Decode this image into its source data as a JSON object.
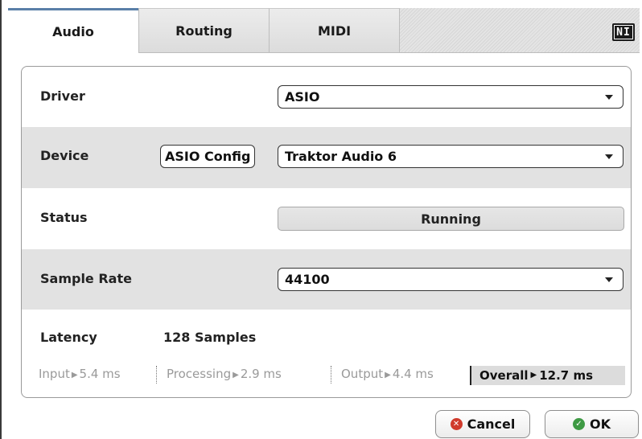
{
  "tabs": [
    {
      "label": "Audio",
      "active": true
    },
    {
      "label": "Routing",
      "active": false
    },
    {
      "label": "MIDI",
      "active": false
    }
  ],
  "logo_text": "NI",
  "settings": {
    "driver": {
      "label": "Driver",
      "value": "ASIO"
    },
    "device": {
      "label": "Device",
      "config_button": "ASIO Config",
      "value": "Traktor Audio 6"
    },
    "status": {
      "label": "Status",
      "value": "Running"
    },
    "sample_rate": {
      "label": "Sample Rate",
      "value": "44100"
    }
  },
  "latency": {
    "label": "Latency",
    "value": "128 Samples",
    "input": {
      "label": "Input",
      "value": "5.4 ms"
    },
    "processing": {
      "label": "Processing",
      "value": "2.9 ms"
    },
    "output": {
      "label": "Output",
      "value": "4.4 ms"
    },
    "overall": {
      "label": "Overall",
      "value": "12.7 ms"
    },
    "arrow_glyph": "▶"
  },
  "buttons": {
    "cancel": "Cancel",
    "ok": "OK"
  },
  "icons": {
    "cancel": "x-circle-icon",
    "ok": "check-circle-icon"
  },
  "colors": {
    "active_tab_accent": "#5a7fa8",
    "cancel_icon": "#d03a2c",
    "ok_icon": "#3e9a44"
  }
}
